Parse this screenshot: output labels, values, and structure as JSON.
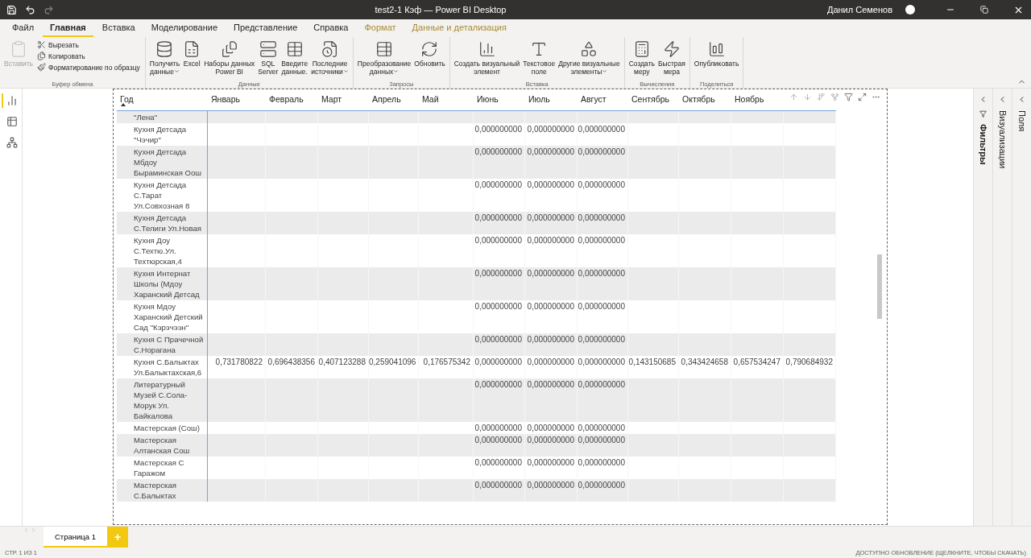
{
  "window": {
    "title": "test2-1 Кэф — Power BI Desktop",
    "user": "Данил Семенов"
  },
  "tabs": [
    {
      "label": "Файл",
      "selected": false,
      "contextual": false
    },
    {
      "label": "Главная",
      "selected": true,
      "contextual": false
    },
    {
      "label": "Вставка",
      "selected": false,
      "contextual": false
    },
    {
      "label": "Моделирование",
      "selected": false,
      "contextual": false
    },
    {
      "label": "Представление",
      "selected": false,
      "contextual": false
    },
    {
      "label": "Справка",
      "selected": false,
      "contextual": false
    },
    {
      "label": "Формат",
      "selected": false,
      "contextual": true
    },
    {
      "label": "Данные и детализация",
      "selected": false,
      "contextual": true
    }
  ],
  "ribbon": [
    {
      "title": "Буфер обмена",
      "items": [
        {
          "kind": "large",
          "label": "Вставить",
          "disabled": true
        },
        {
          "kind": "small",
          "label": "Вырезать",
          "disabled": false
        },
        {
          "kind": "small",
          "label": "Копировать",
          "disabled": false
        },
        {
          "kind": "small",
          "label": "Форматирование по образцу",
          "disabled": false
        }
      ]
    },
    {
      "title": "Данные",
      "items": [
        {
          "kind": "large",
          "label": "Получить\nданные",
          "dropdown": true
        },
        {
          "kind": "large",
          "label": "Excel"
        },
        {
          "kind": "large",
          "label": "Наборы данных\nPower BI"
        },
        {
          "kind": "large",
          "label": "SQL\nServer"
        },
        {
          "kind": "large",
          "label": "Введите\nданные."
        },
        {
          "kind": "large",
          "label": "Последние\nисточники",
          "dropdown": true
        }
      ]
    },
    {
      "title": "Запросы",
      "items": [
        {
          "kind": "large",
          "label": "Преобразование\nданных",
          "dropdown": true
        },
        {
          "kind": "large",
          "label": "Обновить"
        }
      ]
    },
    {
      "title": "Вставка",
      "items": [
        {
          "kind": "large",
          "label": "Создать визуальный\nэлемент"
        },
        {
          "kind": "large",
          "label": "Текстовое\nполе"
        },
        {
          "kind": "large",
          "label": "Другие визуальные\nэлементы",
          "dropdown": true
        }
      ]
    },
    {
      "title": "Вычисления",
      "items": [
        {
          "kind": "large",
          "label": "Создать\nмеру"
        },
        {
          "kind": "large",
          "label": "Быстрая\nмера"
        }
      ]
    },
    {
      "title": "Поделиться",
      "items": [
        {
          "kind": "large",
          "label": "Опубликовать"
        }
      ]
    }
  ],
  "nav": [
    {
      "selected": true
    },
    {
      "selected": false
    },
    {
      "selected": false
    }
  ],
  "table": {
    "columns": [
      "Год",
      "Январь",
      "Февраль",
      "Март",
      "Апрель",
      "Май",
      "Июнь",
      "Июль",
      "Август",
      "Сентябрь",
      "Октябрь",
      "Ноябрь"
    ],
    "rows": [
      {
        "label": "\"Лена\"",
        "kind": "label_only"
      },
      {
        "label": "Кухня Детсада \"Чэчир\"",
        "kind": "summer_only",
        "values": [
          "0,000000000",
          "0,000000000",
          "0,000000000"
        ]
      },
      {
        "label": "Кухня Детсада Мбдоу Быраминская Оош",
        "kind": "summer_only",
        "values": [
          "0,000000000",
          "0,000000000",
          "0,000000000"
        ]
      },
      {
        "label": "Кухня Детсада С.Тарат Ул.Совхозная 8",
        "kind": "summer_only",
        "values": [
          "0,000000000",
          "0,000000000",
          "0,000000000"
        ]
      },
      {
        "label": "Кухня Детсада С.Телиги Ул.Новая",
        "kind": "summer_only",
        "values": [
          "0,000000000",
          "0,000000000",
          "0,000000000"
        ]
      },
      {
        "label": "Кухня Доу С.Техтю.Ул. Техтюрская,4",
        "kind": "summer_only",
        "values": [
          "0,000000000",
          "0,000000000",
          "0,000000000"
        ]
      },
      {
        "label": "Кухня Интернат Школы (Мдоу Харанский Детсад",
        "kind": "summer_only",
        "values": [
          "0,000000000",
          "0,000000000",
          "0,000000000"
        ]
      },
      {
        "label": "Кухня Мдоу Харанский Детский Сад \"Кэрэчээн\"",
        "kind": "summer_only",
        "values": [
          "0,000000000",
          "0,000000000",
          "0,000000000"
        ]
      },
      {
        "label": "Кухня С Прачечной С.Норагана",
        "kind": "summer_only",
        "values": [
          "0,000000000",
          "0,000000000",
          "0,000000000"
        ]
      },
      {
        "label": "Кухня С.Балыктах Ул.Балыктахская,6",
        "kind": "full",
        "values": [
          "0,731780822",
          "0,696438356",
          "0,407123288",
          "0,259041096",
          "0,176575342",
          "0,000000000",
          "0,000000000",
          "0,000000000",
          "0,143150685",
          "0,343424658",
          "0,657534247",
          "0,790684932"
        ]
      },
      {
        "label": "Литературный Музей С.Сола-Морук Ул. Байкалова",
        "kind": "summer_only",
        "values": [
          "0,000000000",
          "0,000000000",
          "0,000000000"
        ]
      },
      {
        "label": "Мастерская (Сош)",
        "kind": "summer_only",
        "values": [
          "0,000000000",
          "0,000000000",
          "0,000000000"
        ]
      },
      {
        "label": "Мастерская Алтанская Сош",
        "kind": "summer_only",
        "values": [
          "0,000000000",
          "0,000000000",
          "0,000000000"
        ]
      },
      {
        "label": "Мастерская С Гаражом",
        "kind": "summer_only",
        "values": [
          "0,000000000",
          "0,000000000",
          "0,000000000"
        ]
      },
      {
        "label": "Мастерская С.Балыктах",
        "kind": "summer_only",
        "values": [
          "0,000000000",
          "0,000000000",
          "0,000000000"
        ]
      }
    ]
  },
  "panes": [
    {
      "label": "Фильтры",
      "bold": true
    },
    {
      "label": "Визуализации",
      "bold": false
    },
    {
      "label": "Поля",
      "bold": false
    }
  ],
  "pages": [
    {
      "label": "Страница 1",
      "selected": true
    }
  ],
  "add_page": "+",
  "status_bar": {
    "left": "СТР. 1 ИЗ 1",
    "right": "ДОСТУПНО ОБНОВЛЕНИЕ (ЩЕЛКНИТЕ, ЧТОБЫ СКАЧАТЬ)"
  }
}
